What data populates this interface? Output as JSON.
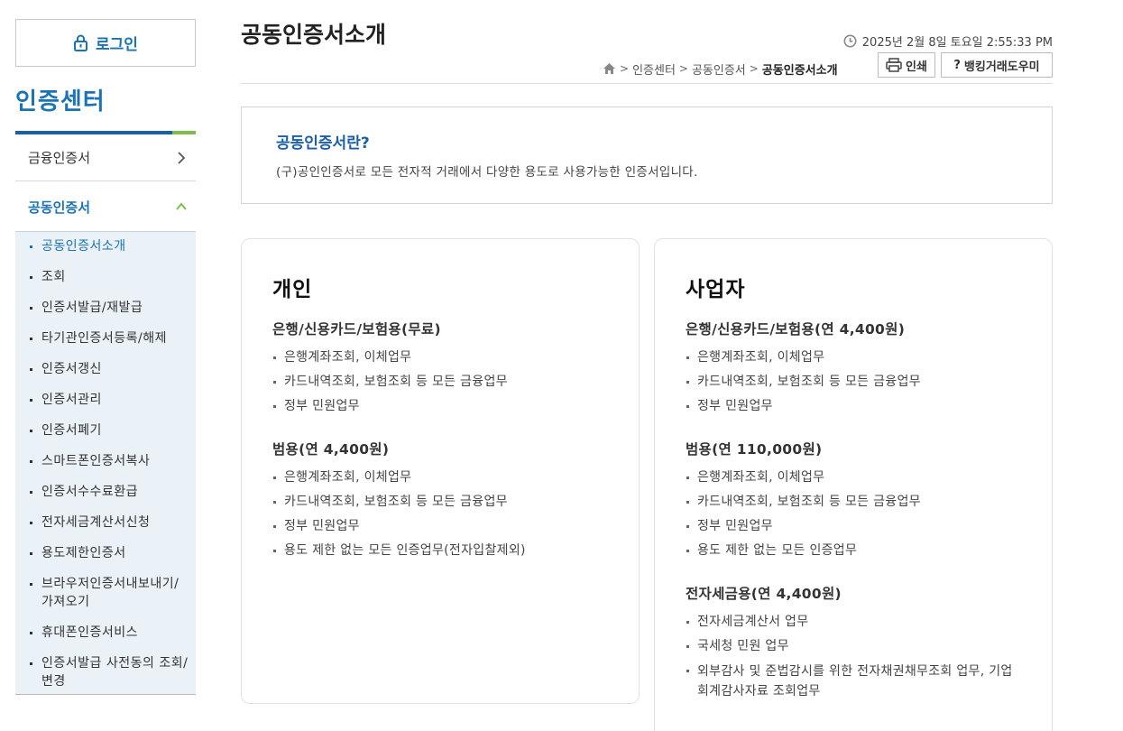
{
  "sidebar": {
    "login_label": "로그인",
    "center_title": "인증센터",
    "menu": [
      {
        "label": "금융인증서"
      },
      {
        "label": "공동인증서"
      }
    ],
    "submenu": [
      {
        "label": "공동인증서소개"
      },
      {
        "label": "조회"
      },
      {
        "label": "인증서발급/재발급"
      },
      {
        "label": "타기관인증서등록/해제"
      },
      {
        "label": "인증서갱신"
      },
      {
        "label": "인증서관리"
      },
      {
        "label": "인증서폐기"
      },
      {
        "label": "스마트폰인증서복사"
      },
      {
        "label": "인증서수수료환급"
      },
      {
        "label": "전자세금계산서신청"
      },
      {
        "label": "용도제한인증서"
      },
      {
        "label": "브라우저인증서내보내기/가져오기"
      },
      {
        "label": "휴대폰인증서비스"
      },
      {
        "label": "인증서발급 사전동의 조회/변경"
      }
    ]
  },
  "header": {
    "title": "공동인증서소개",
    "datetime": "2025년 2월 8일 토요일 2:55:33 PM",
    "breadcrumb": [
      "인증센터",
      "공동인증서",
      "공동인증서소개"
    ],
    "print_label": "인쇄",
    "help_label": "뱅킹거래도우미"
  },
  "intro": {
    "question": "공동인증서란?",
    "description": "(구)공인인증서로 모든 전자적 거래에서 다양한 용도로 사용가능한 인증서입니다."
  },
  "cards": [
    {
      "title": "개인",
      "sections": [
        {
          "heading": "은행/신용카드/보험용(무료)",
          "items": [
            "은행계좌조회, 이체업무",
            "카드내역조회, 보험조회 등 모든 금융업무",
            "정부 민원업무"
          ]
        },
        {
          "heading": "범용(연 4,400원)",
          "items": [
            "은행계좌조회, 이체업무",
            "카드내역조회, 보험조회 등 모든 금융업무",
            "정부 민원업무",
            "용도 제한 없는 모든 인증업무(전자입찰제외)"
          ]
        }
      ]
    },
    {
      "title": "사업자",
      "sections": [
        {
          "heading": "은행/신용카드/보험용(연 4,400원)",
          "items": [
            "은행계좌조회, 이체업무",
            "카드내역조회, 보험조회 등 모든 금융업무",
            "정부 민원업무"
          ]
        },
        {
          "heading": "범용(연 110,000원)",
          "items": [
            "은행계좌조회, 이체업무",
            "카드내역조회, 보험조회 등 모든 금융업무",
            "정부 민원업무",
            "용도 제한 없는 모든 인증업무"
          ]
        },
        {
          "heading": "전자세금용(연 4,400원)",
          "items": [
            "전자세금계산서 업무",
            "국세청 민원 업무",
            "외부감사 및 준법감시를 위한 전자채권채무조회 업무, 기업 회계감사자료 조회업무"
          ]
        }
      ]
    }
  ]
}
